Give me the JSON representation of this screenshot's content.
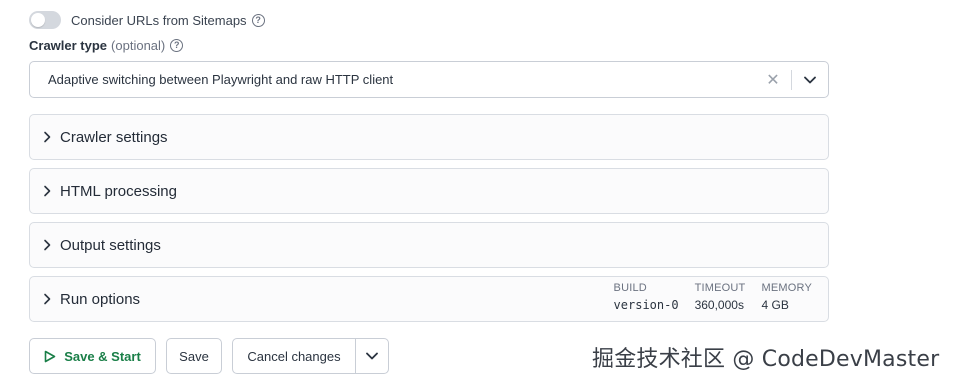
{
  "sitemaps_toggle": {
    "label": "Consider URLs from Sitemaps",
    "enabled": false,
    "help_icon": "question-circle-icon"
  },
  "crawler_type": {
    "label": "Crawler type",
    "optional_text": "(optional)",
    "help_icon": "question-circle-icon",
    "selected_value": "Adaptive switching between Playwright and raw HTTP client",
    "clear_icon": "close-icon",
    "dropdown_icon": "chevron-down-icon"
  },
  "sections": [
    {
      "title": "Crawler settings",
      "icon": "chevron-right-icon"
    },
    {
      "title": "HTML processing",
      "icon": "chevron-right-icon"
    },
    {
      "title": "Output settings",
      "icon": "chevron-right-icon"
    },
    {
      "title": "Run options",
      "icon": "chevron-right-icon"
    }
  ],
  "run_stats": {
    "build": {
      "label": "BUILD",
      "value": "version-0"
    },
    "timeout": {
      "label": "TIMEOUT",
      "value": "360,000s"
    },
    "memory": {
      "label": "MEMORY",
      "value": "4 GB"
    }
  },
  "actions": {
    "save_start": "Save & Start",
    "save": "Save",
    "cancel": "Cancel changes"
  },
  "colors": {
    "accent_green": "#1a7f48"
  },
  "watermark": "掘金技术社区 @ CodeDevMaster"
}
